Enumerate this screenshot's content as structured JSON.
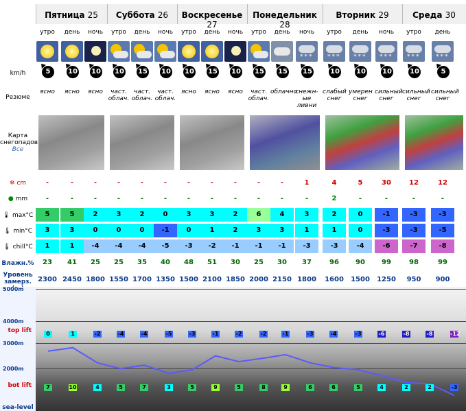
{
  "days": [
    {
      "name": "Пятница",
      "num": "25"
    },
    {
      "name": "Суббота",
      "num": "26"
    },
    {
      "name": "Воскресенье",
      "num": "27"
    },
    {
      "name": "Понедельник",
      "num": "28"
    },
    {
      "name": "Вторник",
      "num": "29"
    },
    {
      "name": "Среда",
      "num": "30"
    }
  ],
  "periods": [
    "утро",
    "день",
    "ночь",
    "утро",
    "день",
    "ночь",
    "утро",
    "день",
    "ночь",
    "утро",
    "день",
    "ночь",
    "утро",
    "день",
    "ночь",
    "утро",
    "день"
  ],
  "labels": {
    "wind": "km/h",
    "summary": "Резюме",
    "map": "Карта снегопадов",
    "map_link": "Все",
    "snow": "cm",
    "rain": "mm",
    "max": "max°C",
    "min": "min°C",
    "chill": "chill°C",
    "humidity": "Влажн.%",
    "freezing": "Уровень замерз. (m)",
    "top": "top lift",
    "bot": "bot lift",
    "sea": "sea-level"
  },
  "wind": [
    "5",
    "10",
    "10",
    "10",
    "15",
    "10",
    "10",
    "15",
    "10",
    "15",
    "15",
    "15",
    "10",
    "10",
    "10",
    "10",
    "5"
  ],
  "summary": [
    "ясно",
    "ясно",
    "ясно",
    "част. облач.",
    "част. облач.",
    "част. облач.",
    "ясно",
    "ясно",
    "ясно",
    "част. облач.",
    "облачно",
    "снежн-ые ливни",
    "слабый снег",
    "умерен снег",
    "сильный снег",
    "сильный снег",
    "сильный снег"
  ],
  "snow": [
    "-",
    "-",
    "-",
    "-",
    "-",
    "-",
    "-",
    "-",
    "-",
    "-",
    "-",
    "1",
    "4",
    "5",
    "30",
    "12",
    "12"
  ],
  "rain": [
    "-",
    "-",
    "-",
    "-",
    "-",
    "-",
    "-",
    "-",
    "-",
    "-",
    "-",
    "-",
    "2",
    "-",
    "-",
    "-",
    "-"
  ],
  "max": [
    "5",
    "5",
    "2",
    "3",
    "2",
    "0",
    "3",
    "3",
    "2",
    "6",
    "4",
    "3",
    "2",
    "0",
    "-1",
    "-3",
    "-3"
  ],
  "min": [
    "3",
    "3",
    "0",
    "0",
    "0",
    "-1",
    "0",
    "1",
    "2",
    "3",
    "3",
    "1",
    "1",
    "0",
    "-3",
    "-3",
    "-5"
  ],
  "chill": [
    "1",
    "1",
    "-4",
    "-4",
    "-4",
    "-5",
    "-3",
    "-2",
    "-1",
    "-1",
    "-1",
    "-3",
    "-3",
    "-4",
    "-6",
    "-7",
    "-8"
  ],
  "humidity": [
    "23",
    "41",
    "25",
    "25",
    "35",
    "40",
    "48",
    "51",
    "30",
    "25",
    "30",
    "37",
    "96",
    "90",
    "99",
    "98",
    "99"
  ],
  "freezing": [
    "2300",
    "2450",
    "1800",
    "1550",
    "1700",
    "1350",
    "1500",
    "2100",
    "1850",
    "2000",
    "2150",
    "1800",
    "1600",
    "1500",
    "1250",
    "950",
    "900"
  ],
  "chart": {
    "levels": [
      "5000m",
      "4000m",
      "3000m",
      "2000m",
      "1000m"
    ],
    "top": [
      "0",
      "1",
      "-2",
      "-4",
      "-4",
      "-5",
      "-3",
      "-1",
      "-2",
      "-2",
      "-1",
      "-3",
      "-4",
      "-3",
      "-6",
      "-8",
      "-8",
      "-12"
    ],
    "bot": [
      "7",
      "10",
      "4",
      "5",
      "7",
      "3",
      "5",
      "9",
      "5",
      "8",
      "9",
      "6",
      "6",
      "5",
      "4",
      "2",
      "2",
      "-3"
    ]
  },
  "colors": {
    "cyan": "#00ffff",
    "green": "#33cc66",
    "lightgreen": "#99ff99",
    "blue": "#3366ff",
    "lightblue": "#99ccff",
    "purple": "#cc66cc"
  }
}
